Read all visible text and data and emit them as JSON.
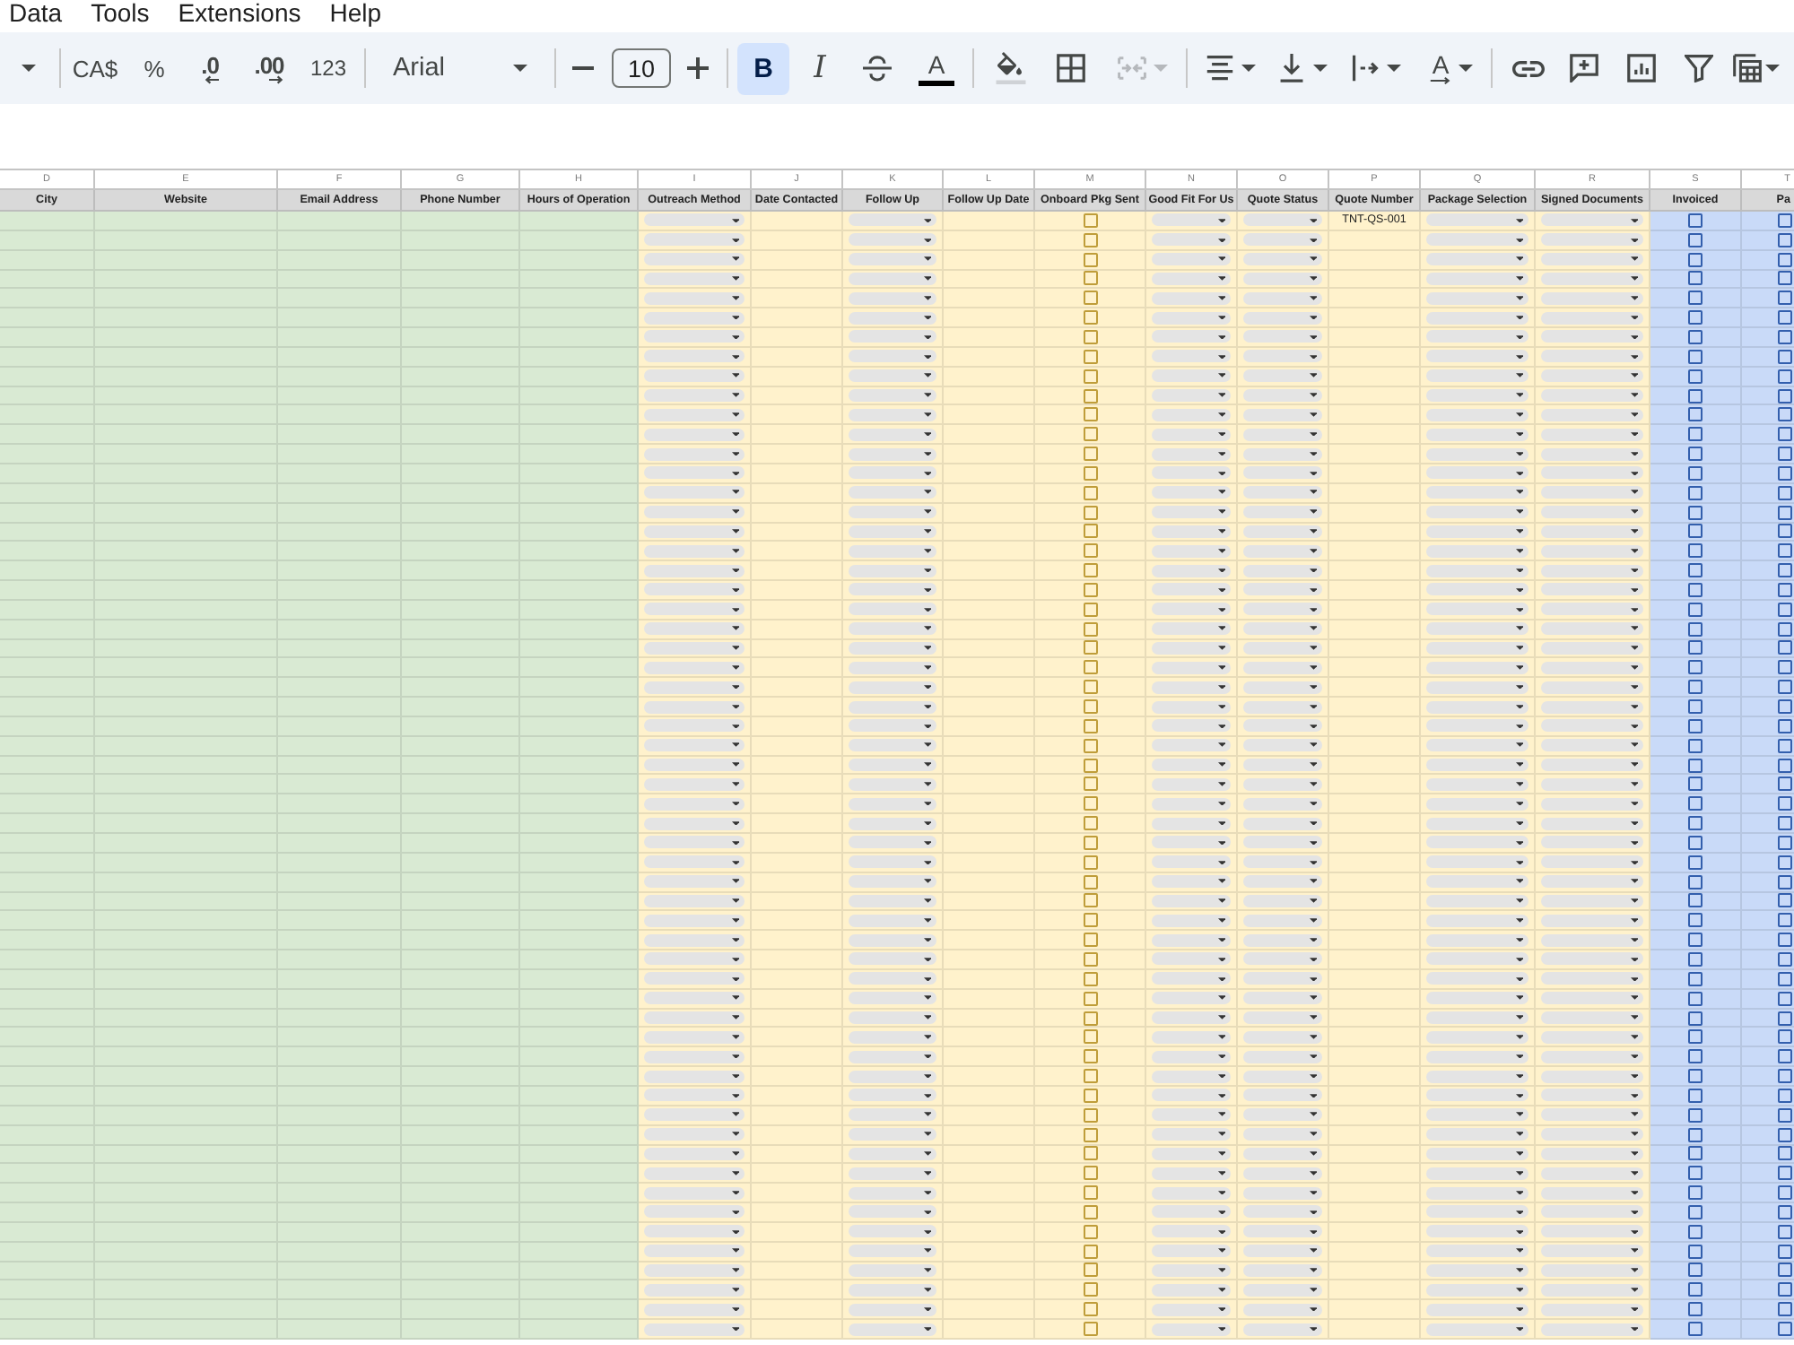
{
  "menu": [
    {
      "label": "Data"
    },
    {
      "label": "Tools"
    },
    {
      "label": "Extensions"
    },
    {
      "label": "Help"
    }
  ],
  "toolbar": {
    "currency": "CA$",
    "percent": "%",
    "decrease_decimals": ".0",
    "increase_decimals": ".00",
    "more_formats": "123",
    "font": "Arial",
    "font_size": "10",
    "bold": {
      "label": "B",
      "selected": true
    },
    "italic": {
      "label": "I",
      "selected": false
    },
    "strikethrough": {
      "selected": false
    },
    "text_color": "A",
    "merge": {
      "disabled": true
    },
    "text_rotation": "A"
  },
  "sheet": {
    "columns": [
      {
        "letter": "D",
        "header": "City",
        "kind": "text",
        "color": "#d9ead3"
      },
      {
        "letter": "E",
        "header": "Website",
        "kind": "text",
        "color": "#d9ead3"
      },
      {
        "letter": "F",
        "header": "Email Address",
        "kind": "text",
        "color": "#d9ead3"
      },
      {
        "letter": "G",
        "header": "Phone Number",
        "kind": "text",
        "color": "#d9ead3"
      },
      {
        "letter": "H",
        "header": "Hours of Operation",
        "kind": "text",
        "color": "#d9ead3"
      },
      {
        "letter": "I",
        "header": "Outreach Method",
        "kind": "dropdown",
        "color": "#fff2cc"
      },
      {
        "letter": "J",
        "header": "Date Contacted",
        "kind": "text",
        "color": "#fff2cc"
      },
      {
        "letter": "K",
        "header": "Follow Up",
        "kind": "dropdown",
        "color": "#fff2cc"
      },
      {
        "letter": "L",
        "header": "Follow Up Date",
        "kind": "text",
        "color": "#fff2cc"
      },
      {
        "letter": "M",
        "header": "Onboard Pkg Sent",
        "kind": "checkbox",
        "color": "#fff2cc"
      },
      {
        "letter": "N",
        "header": "Good Fit For Us",
        "kind": "dropdown",
        "color": "#fff2cc"
      },
      {
        "letter": "O",
        "header": "Quote Status",
        "kind": "dropdown",
        "color": "#fff2cc"
      },
      {
        "letter": "P",
        "header": "Quote Number",
        "kind": "text",
        "color": "#fff2cc"
      },
      {
        "letter": "Q",
        "header": "Package Selection",
        "kind": "dropdown",
        "color": "#fff2cc"
      },
      {
        "letter": "R",
        "header": "Signed Documents",
        "kind": "dropdown",
        "color": "#fff2cc"
      },
      {
        "letter": "S",
        "header": "Invoiced",
        "kind": "checkbox",
        "color": "#c9daf8"
      },
      {
        "letter": "T",
        "header": "Pa",
        "kind": "checkbox",
        "color": "#c9daf8"
      }
    ],
    "rows": [
      {
        "quote_number": "TNT-QS-001",
        "checked": [
          false,
          false,
          false
        ]
      },
      {
        "checked": [
          false,
          false,
          false
        ]
      },
      {
        "checked": [
          false,
          false,
          false
        ]
      },
      {
        "checked": [
          false,
          false,
          false
        ]
      },
      {
        "checked": [
          false,
          false,
          false
        ]
      },
      {
        "checked": [
          false,
          false,
          false
        ]
      },
      {
        "checked": [
          false,
          false,
          false
        ]
      },
      {
        "checked": [
          false,
          false,
          false
        ]
      },
      {
        "checked": [
          false,
          false,
          false
        ]
      },
      {
        "checked": [
          false,
          false,
          false
        ]
      },
      {
        "checked": [
          false,
          false,
          false
        ]
      },
      {
        "checked": [
          false,
          false,
          false
        ]
      },
      {
        "checked": [
          false,
          false,
          false
        ]
      },
      {
        "checked": [
          false,
          false,
          false
        ]
      },
      {
        "checked": [
          false,
          false,
          false
        ]
      },
      {
        "checked": [
          false,
          false,
          false
        ]
      },
      {
        "checked": [
          false,
          false,
          false
        ]
      },
      {
        "checked": [
          false,
          false,
          false
        ]
      },
      {
        "checked": [
          false,
          false,
          false
        ]
      },
      {
        "checked": [
          false,
          false,
          false
        ]
      },
      {
        "checked": [
          false,
          false,
          false
        ]
      },
      {
        "checked": [
          false,
          false,
          false
        ]
      },
      {
        "checked": [
          false,
          false,
          false
        ]
      },
      {
        "checked": [
          false,
          false,
          false
        ]
      },
      {
        "checked": [
          false,
          false,
          false
        ]
      },
      {
        "checked": [
          false,
          false,
          false
        ]
      },
      {
        "checked": [
          false,
          false,
          false
        ]
      },
      {
        "checked": [
          false,
          false,
          false
        ]
      },
      {
        "checked": [
          false,
          false,
          false
        ]
      },
      {
        "checked": [
          false,
          false,
          false
        ]
      },
      {
        "checked": [
          false,
          false,
          false
        ]
      },
      {
        "checked": [
          false,
          false,
          false
        ]
      },
      {
        "checked": [
          false,
          false,
          false
        ]
      },
      {
        "checked": [
          false,
          false,
          false
        ]
      },
      {
        "checked": [
          false,
          false,
          false
        ]
      },
      {
        "checked": [
          false,
          false,
          false
        ]
      },
      {
        "checked": [
          false,
          false,
          false
        ]
      },
      {
        "checked": [
          false,
          false,
          false
        ]
      },
      {
        "checked": [
          false,
          false,
          false
        ]
      },
      {
        "checked": [
          false,
          false,
          false
        ]
      },
      {
        "checked": [
          false,
          false,
          false
        ]
      },
      {
        "checked": [
          false,
          false,
          false
        ]
      },
      {
        "checked": [
          false,
          false,
          false
        ]
      },
      {
        "checked": [
          false,
          false,
          false
        ]
      },
      {
        "checked": [
          false,
          false,
          false
        ]
      },
      {
        "checked": [
          false,
          false,
          false
        ]
      },
      {
        "checked": [
          false,
          false,
          false
        ]
      },
      {
        "checked": [
          false,
          false,
          false
        ]
      },
      {
        "checked": [
          false,
          false,
          false
        ]
      },
      {
        "checked": [
          false,
          false,
          false
        ]
      },
      {
        "checked": [
          false,
          false,
          false
        ]
      },
      {
        "checked": [
          false,
          false,
          false
        ]
      },
      {
        "checked": [
          false,
          false,
          false
        ]
      },
      {
        "checked": [
          false,
          false,
          false
        ]
      },
      {
        "checked": [
          false,
          false,
          false
        ]
      },
      {
        "checked": [
          false,
          false,
          false
        ]
      },
      {
        "checked": [
          false,
          false,
          false
        ]
      },
      {
        "checked": [
          false,
          false,
          false
        ]
      }
    ]
  }
}
